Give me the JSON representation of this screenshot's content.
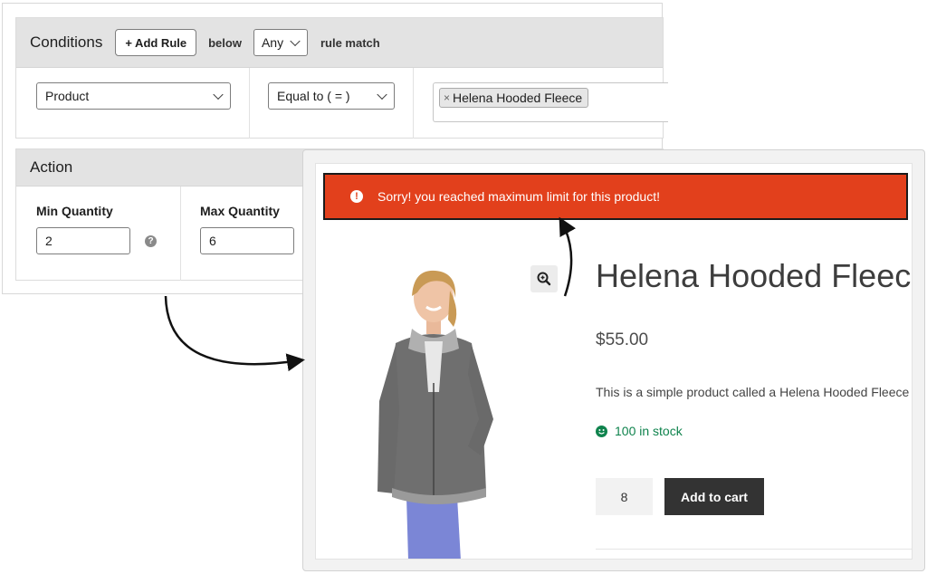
{
  "conditions": {
    "title": "Conditions",
    "add_rule_label": "+ Add Rule",
    "below_label": "below",
    "match_mode": "Any",
    "rule_match_label": "rule match",
    "field_select": "Product",
    "operator_select": "Equal to ( = )",
    "tag_value": "Helena Hooded Fleece",
    "tag_remove": "×"
  },
  "action": {
    "title": "Action",
    "min_label": "Min Quantity",
    "min_value": "2",
    "max_label": "Max Quantity",
    "max_value": "6",
    "help_glyph": "?"
  },
  "store": {
    "notice_icon": "!",
    "notice_text": "Sorry! you reached maximum limit for this product!",
    "product_title": "Helena Hooded Fleece",
    "price": "$55.00",
    "description": "This is a simple product called a Helena Hooded Fleece",
    "stock": "100 in stock",
    "quantity": "8",
    "add_to_cart": "Add to cart"
  },
  "colors": {
    "notice_bg": "#e2401c",
    "stock_green": "#0f834d",
    "cart_button": "#333333",
    "admin_header": "#e3e3e3"
  },
  "icons": [
    "chevron-down-icon",
    "help-icon",
    "warning-icon",
    "zoom-icon",
    "smile-icon",
    "remove-tag-icon"
  ]
}
